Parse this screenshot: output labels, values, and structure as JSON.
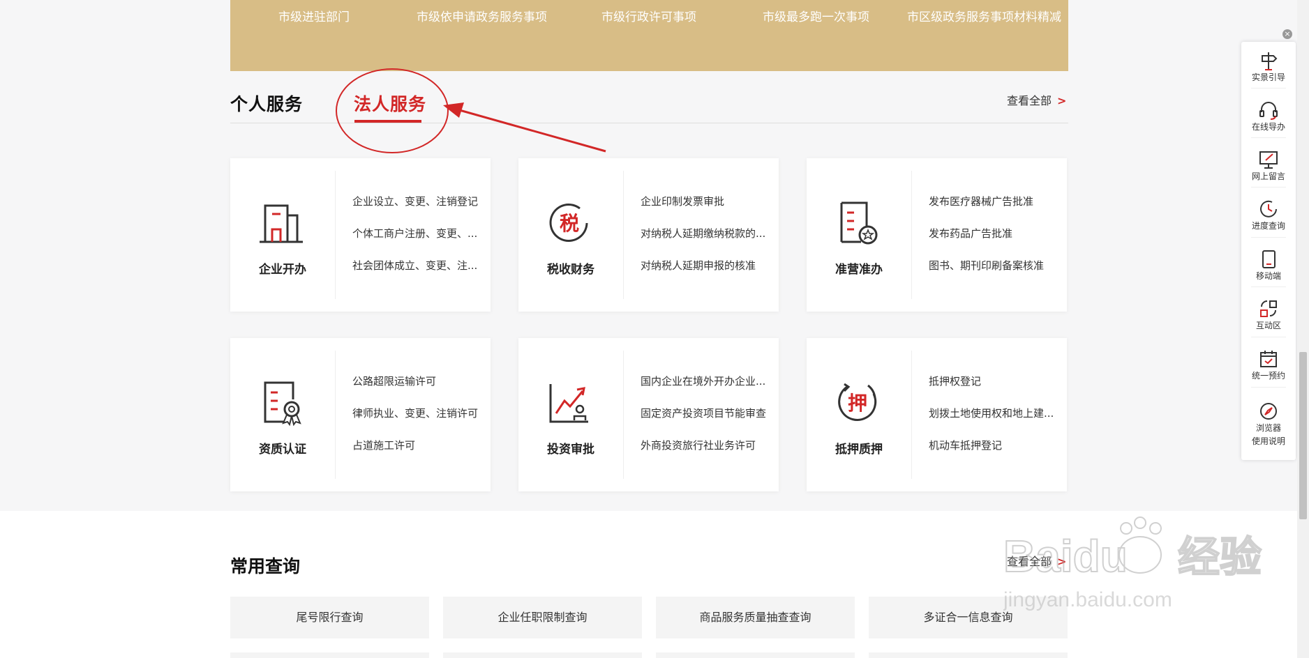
{
  "banner": {
    "items": [
      "市级进驻部门",
      "市级依申请政务服务事项",
      "市级行政许可事项",
      "市级最多跑一次事项",
      "市区级政务服务事项材料精减"
    ]
  },
  "tabs": {
    "personal": "个人服务",
    "legal": "法人服务"
  },
  "view_all": {
    "label": "查看全部",
    "arrow": ">"
  },
  "cards": [
    {
      "title": "企业开办",
      "icon": "building-icon",
      "links": [
        "企业设立、变更、注销登记",
        "个体工商户注册、变更、...",
        "社会团体成立、变更、注..."
      ]
    },
    {
      "title": "税收财务",
      "icon": "tax-icon",
      "icon_text": "税",
      "links": [
        "企业印制发票审批",
        "对纳税人延期缴纳税款的...",
        "对纳税人延期申报的核准"
      ]
    },
    {
      "title": "准营准办",
      "icon": "document-star-icon",
      "links": [
        "发布医疗器械广告批准",
        "发布药品广告批准",
        "图书、期刊印刷备案核准"
      ]
    },
    {
      "title": "资质认证",
      "icon": "certificate-icon",
      "links": [
        "公路超限运输许可",
        "律师执业、变更、注销许可",
        "占道施工许可"
      ]
    },
    {
      "title": "投资审批",
      "icon": "investment-chart-icon",
      "links": [
        "国内企业在境外开办企业...",
        "固定资产投资项目节能审查",
        "外商投资旅行社业务许可"
      ]
    },
    {
      "title": "抵押质押",
      "icon": "mortgage-icon",
      "icon_text": "押",
      "links": [
        "抵押权登记",
        "划拨土地使用权和地上建...",
        "机动车抵押登记"
      ]
    }
  ],
  "common_query": {
    "title": "常用查询",
    "view_all": "查看全部",
    "items": [
      "尾号限行查询",
      "企业任职限制查询",
      "商品服务质量抽查查询",
      "多证合一信息查询"
    ]
  },
  "toolbar": {
    "close": "×",
    "items": [
      {
        "label": "实景引导",
        "icon": "signpost-icon"
      },
      {
        "label": "在线导办",
        "icon": "headset-icon"
      },
      {
        "label": "网上留言",
        "icon": "message-edit-icon"
      },
      {
        "label": "进度查询",
        "icon": "clock-icon"
      },
      {
        "label": "移动端",
        "icon": "tablet-icon"
      },
      {
        "label": "互动区",
        "icon": "interaction-icon"
      },
      {
        "label": "统一预约",
        "icon": "calendar-check-icon"
      },
      {
        "label": "浏览器",
        "label2": "使用说明",
        "icon": "compass-icon"
      }
    ]
  },
  "watermark": {
    "brand": "Baidu",
    "cn": "经验",
    "url": "jingyan.baidu.com"
  },
  "colors": {
    "accent": "#d22727",
    "banner": "#d8bd86",
    "background": "#f6f6f7"
  }
}
